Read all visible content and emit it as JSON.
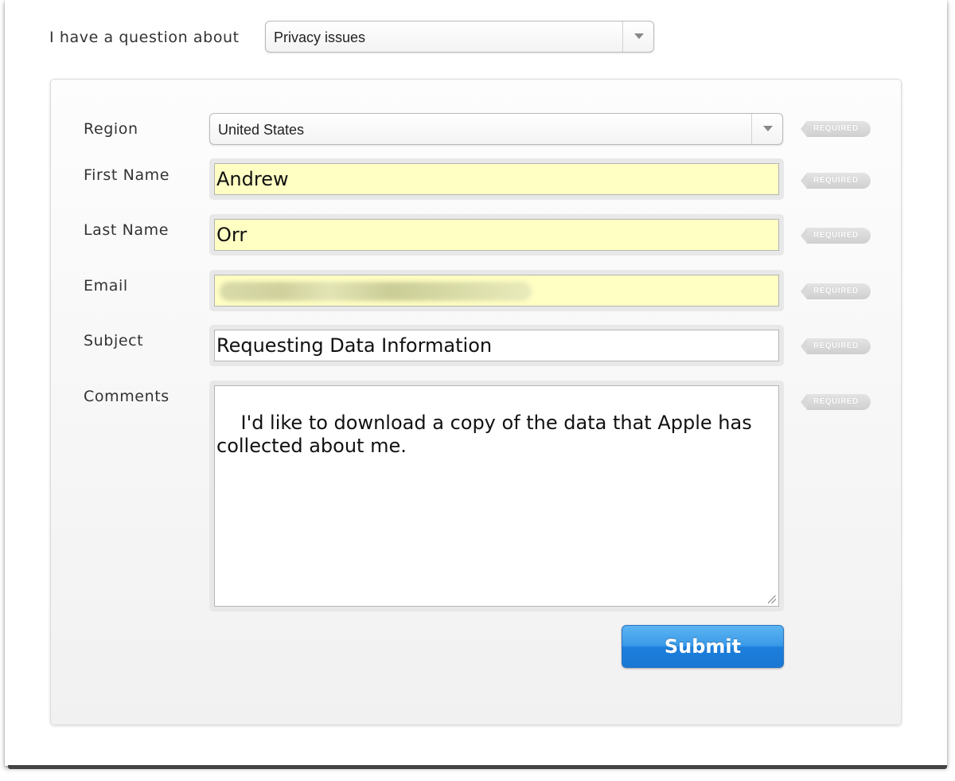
{
  "topic": {
    "label": "I have a question about",
    "selected": "Privacy issues"
  },
  "form": {
    "required_tag": "REQUIRED",
    "region": {
      "label": "Region",
      "value": "United States"
    },
    "first_name": {
      "label": "First Name",
      "value": "Andrew"
    },
    "last_name": {
      "label": "Last Name",
      "value": "Orr"
    },
    "email": {
      "label": "Email",
      "value": ""
    },
    "subject": {
      "label": "Subject",
      "value": "Requesting Data Information"
    },
    "comments": {
      "label": "Comments",
      "value": "I'd like to download a copy of the data that Apple has\ncollected about me."
    },
    "submit_label": "Submit"
  },
  "icons": {
    "dropdown": "chevron-down-icon",
    "resize": "resize-grip-icon",
    "required": "required-tag-icon"
  },
  "colors": {
    "autofill": "#ffffc4",
    "submit": "#1c7fdc"
  }
}
